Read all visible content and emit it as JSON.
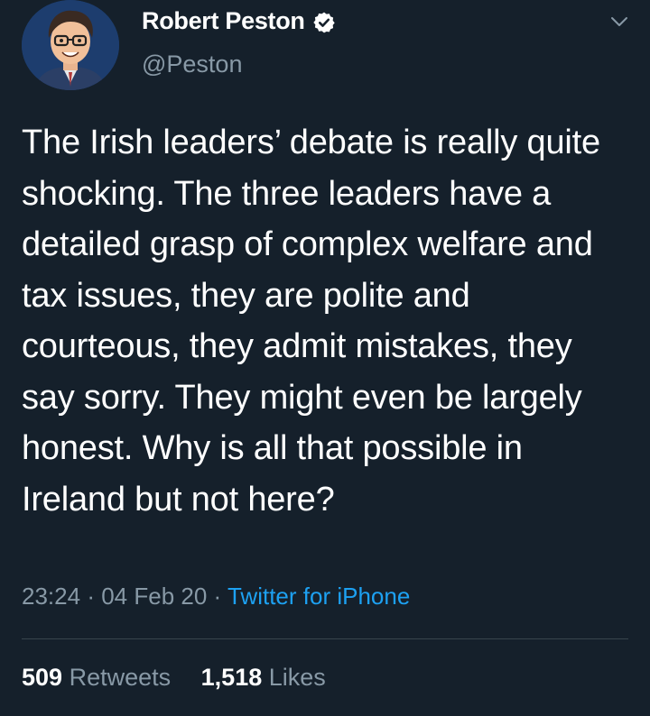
{
  "author": {
    "display_name": "Robert Peston",
    "handle": "@Peston",
    "verified": true,
    "avatar_icon": "cartoon-portrait-avatar"
  },
  "tweet": {
    "text": "The Irish leaders’ debate is really quite shocking. The three leaders have a detailed grasp of complex welfare and tax issues, they are polite and courteous, they admit mistakes, they say sorry. They might even be largely honest. Why is all that possible in Ireland but not here?",
    "time": "23:24",
    "separator": "·",
    "date": "04 Feb 20",
    "source": "Twitter for iPhone"
  },
  "stats": {
    "retweets_count": "509",
    "retweets_label": "Retweets",
    "likes_count": "1,518",
    "likes_label": "Likes"
  },
  "colors": {
    "background": "#15202b",
    "text_primary": "#ffffff",
    "text_secondary": "#8899a6",
    "link": "#1da1f2",
    "divider": "#38444d"
  },
  "icons": {
    "verified": "verified-badge-icon",
    "menu": "chevron-down-icon"
  }
}
